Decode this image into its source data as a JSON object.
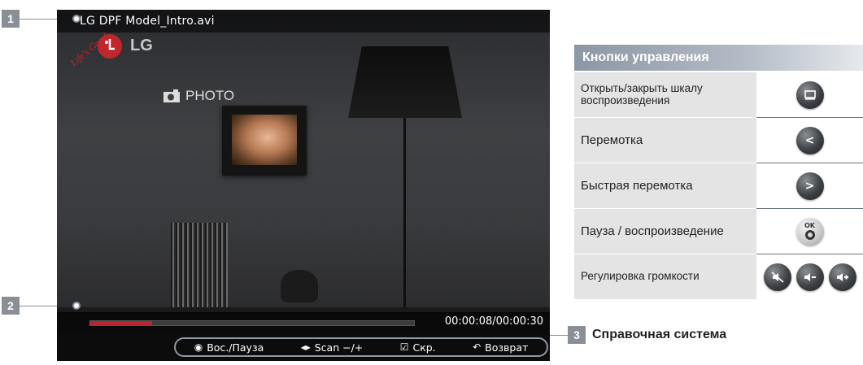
{
  "callouts": {
    "one": "1",
    "two": "2",
    "three": "3"
  },
  "player": {
    "file_title": "LG DPF Model_Intro.avi",
    "brand": "LG",
    "brand_tagline": "Life's Good",
    "photo_label": "PHOTO",
    "time": "00:00:08/00:00:30",
    "progress_fraction": 0.19
  },
  "help_bar": {
    "items": [
      {
        "icon": "◉",
        "label": "Вос./Пауза"
      },
      {
        "icon": "◂▸",
        "label": "Scan −/+"
      },
      {
        "icon": "☑",
        "label": "Скр."
      },
      {
        "icon": "↶",
        "label": "Возврат"
      }
    ],
    "section_title": "Справочная система"
  },
  "panel": {
    "title": "Кнопки управления",
    "rows": [
      {
        "label": "Открыть/закрыть шкалу воспроизведения",
        "buttons": [
          "display-icon"
        ]
      },
      {
        "label": "Перемотка",
        "buttons": [
          "chevron-left-icon"
        ]
      },
      {
        "label": "Быстрая перемотка",
        "buttons": [
          "chevron-right-icon"
        ]
      },
      {
        "label": "Пауза / воспроизведение",
        "buttons": [
          "ok-button-icon"
        ],
        "ok_text": "OK"
      },
      {
        "label": "Регулировка громкости",
        "buttons": [
          "mute-icon",
          "volume-down-icon",
          "volume-up-icon"
        ]
      }
    ]
  },
  "colors": {
    "accent": "#b82530",
    "callout": "#8a8f97",
    "panel_header": "#8c97a5"
  }
}
